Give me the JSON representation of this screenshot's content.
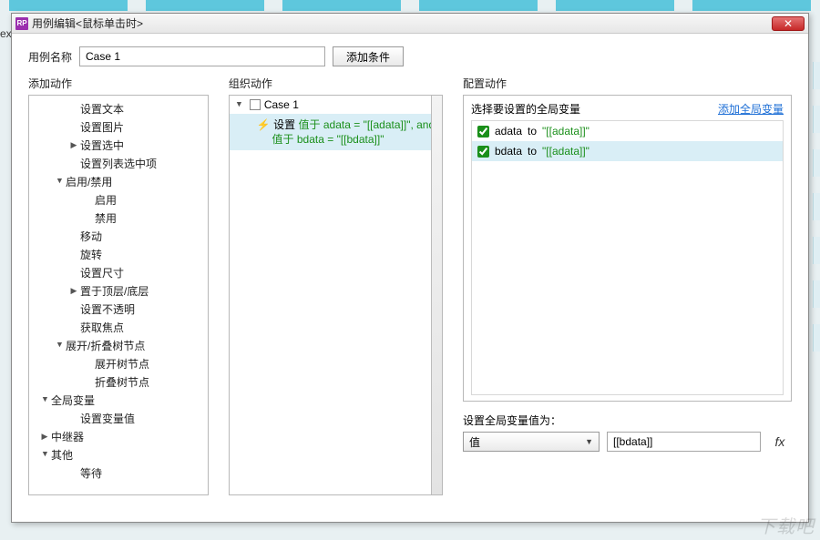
{
  "bg_label": "ex",
  "window": {
    "icon_text": "RP",
    "title": "用例编辑<鼠标单击时>"
  },
  "name_row": {
    "label": "用例名称",
    "value": "Case 1",
    "add_condition": "添加条件"
  },
  "columns": {
    "left_title": "添加动作",
    "mid_title": "组织动作",
    "right_title": "配置动作"
  },
  "add_actions": [
    {
      "indent": 2,
      "arrow": "",
      "label": "设置文本"
    },
    {
      "indent": 2,
      "arrow": "",
      "label": "设置图片"
    },
    {
      "indent": 2,
      "arrow": "closed",
      "label": "设置选中"
    },
    {
      "indent": 2,
      "arrow": "",
      "label": "设置列表选中项"
    },
    {
      "indent": 1,
      "arrow": "open",
      "label": "启用/禁用"
    },
    {
      "indent": 3,
      "arrow": "",
      "label": "启用"
    },
    {
      "indent": 3,
      "arrow": "",
      "label": "禁用"
    },
    {
      "indent": 2,
      "arrow": "",
      "label": "移动"
    },
    {
      "indent": 2,
      "arrow": "",
      "label": "旋转"
    },
    {
      "indent": 2,
      "arrow": "",
      "label": "设置尺寸"
    },
    {
      "indent": 2,
      "arrow": "closed",
      "label": "置于顶层/底层"
    },
    {
      "indent": 2,
      "arrow": "",
      "label": "设置不透明"
    },
    {
      "indent": 2,
      "arrow": "",
      "label": "获取焦点"
    },
    {
      "indent": 1,
      "arrow": "open",
      "label": "展开/折叠树节点"
    },
    {
      "indent": 3,
      "arrow": "",
      "label": "展开树节点"
    },
    {
      "indent": 3,
      "arrow": "",
      "label": "折叠树节点"
    },
    {
      "indent": 0,
      "arrow": "open",
      "label": "全局变量"
    },
    {
      "indent": 2,
      "arrow": "",
      "label": "设置变量值"
    },
    {
      "indent": 0,
      "arrow": "closed",
      "label": "中继器"
    },
    {
      "indent": 0,
      "arrow": "open",
      "label": "其他"
    },
    {
      "indent": 2,
      "arrow": "",
      "label": "等待"
    }
  ],
  "organize": {
    "case_label": "Case 1",
    "action_prefix": "设置",
    "line1_a": "值于",
    "line1_b": "adata = \"[[adata]]\", and",
    "line2_a": "值于",
    "line2_b": "bdata = \"[[bdata]]\""
  },
  "configure": {
    "select_label": "选择要设置的全局变量",
    "add_link": "添加全局变量",
    "rows": [
      {
        "name": "adata",
        "to": "to",
        "expr": "\"[[adata]]\""
      },
      {
        "name": "bdata",
        "to": "to",
        "expr": "\"[[adata]]\""
      }
    ],
    "set_value_label": "设置全局变量值为：",
    "select_value": "值",
    "value_input": "[[bdata]]",
    "fx": "fx"
  },
  "watermark": "下载吧"
}
